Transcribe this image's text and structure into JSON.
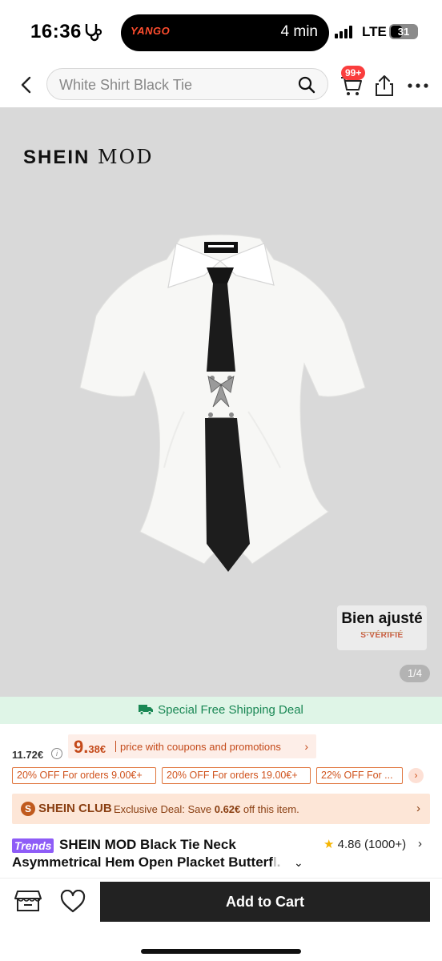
{
  "status_bar": {
    "time": "16:36",
    "activity_app": "YANGO",
    "activity_eta": "4 min",
    "network": "LTE",
    "battery": "31"
  },
  "nav": {
    "search_text": "White Shirt Black Tie",
    "cart_badge": "99+"
  },
  "product_image": {
    "brand_prefix": "SHEIN",
    "brand_suffix": "MOD",
    "fit_badge_title": "Bien ajusté",
    "fit_badge_sub": "S·VÉRIFIÉ",
    "page_indicator": "1/4"
  },
  "shipping": {
    "label": "Special Free Shipping Deal",
    "color": "#198754"
  },
  "price": {
    "original": "11.72€",
    "coupon_price_main": "9.",
    "coupon_price_cents": "38€",
    "coupon_desc": "price with coupons and promotions",
    "accent": "#c44a1a"
  },
  "discounts": [
    "20% OFF For orders 9.00€+",
    "20% OFF For orders 19.00€+",
    "22% OFF For ..."
  ],
  "club": {
    "name": "SHEIN CLUB",
    "text_prefix": "Exclusive Deal: Save ",
    "text_amount": "0.62€",
    "text_suffix": " off this item."
  },
  "title": {
    "badge": "Trends",
    "line1": "SHEIN MOD Black Tie Neck",
    "line2_visible": "Asymmetrical Hem Open Placket Butterf",
    "line2_faded": "l.",
    "rating": "4.86",
    "reviews": "(1000+)"
  },
  "bottom_bar": {
    "add_to_cart": "Add to Cart"
  }
}
